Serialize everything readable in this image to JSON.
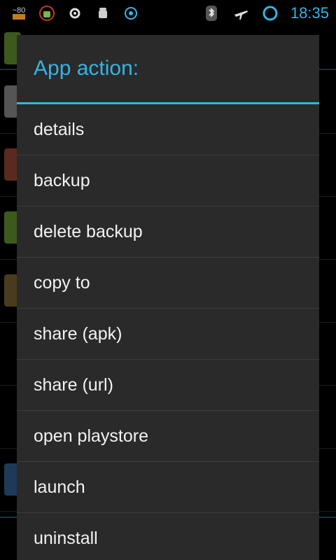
{
  "status_bar": {
    "signal_label": "~80",
    "time": "18:35",
    "icons": [
      "notification-icon",
      "android-icon",
      "settings-icon",
      "android-icon",
      "sync-icon",
      "bluetooth-icon",
      "airplane-mode-icon",
      "loading-ring-icon"
    ]
  },
  "dialog": {
    "title": "App action:",
    "items": [
      {
        "label": "details"
      },
      {
        "label": "backup"
      },
      {
        "label": "delete backup"
      },
      {
        "label": "copy to"
      },
      {
        "label": "share (apk)"
      },
      {
        "label": "share (url)"
      },
      {
        "label": "open playstore"
      },
      {
        "label": "launch"
      },
      {
        "label": "uninstall"
      }
    ]
  },
  "colors": {
    "accent": "#33b5e5",
    "dialog_bg": "#2a2a2a",
    "background": "#000000"
  }
}
